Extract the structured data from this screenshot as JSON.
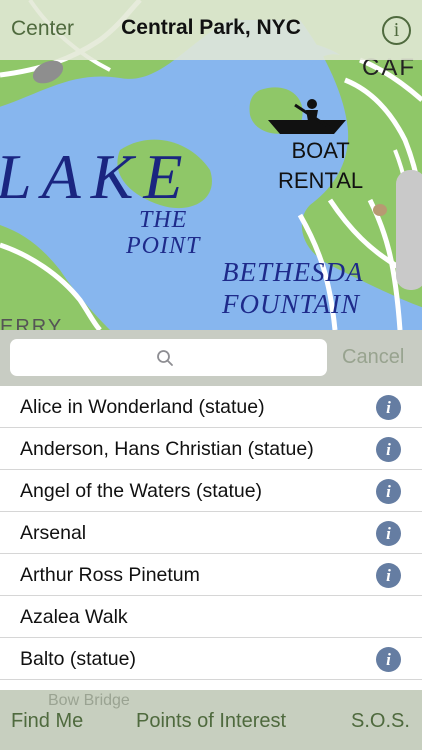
{
  "header": {
    "center_label": "Center",
    "title": "Central Park, NYC",
    "info_label": "i"
  },
  "map": {
    "labels": {
      "lake": "LAKE",
      "the_point": "THE\nPOINT",
      "boat_rental": "BOAT\nRENTAL",
      "bethesda": "BETHESDA\nFOUNTAIN",
      "caf": "CAF",
      "terry": "ERRY"
    },
    "colors": {
      "grass": "#8fc768",
      "water": "#87b6ee",
      "path": "#ffffff",
      "label": "#1e2a8a"
    }
  },
  "search": {
    "placeholder": "",
    "value": "",
    "cancel_label": "Cancel"
  },
  "list": {
    "info_glyph": "i",
    "items": [
      {
        "label": "Alice in Wonderland (statue)",
        "has_info": true
      },
      {
        "label": "Anderson, Hans Christian (statue)",
        "has_info": true
      },
      {
        "label": "Angel of the Waters (statue)",
        "has_info": true
      },
      {
        "label": "Arsenal",
        "has_info": true
      },
      {
        "label": "Arthur Ross Pinetum",
        "has_info": true
      },
      {
        "label": "Azalea Walk",
        "has_info": false
      },
      {
        "label": "Balto (statue)",
        "has_info": true
      },
      {
        "label": "",
        "has_info": false
      }
    ]
  },
  "bottom_bar": {
    "faded_text": "Bow Bridge",
    "tabs": [
      {
        "label": "Find Me"
      },
      {
        "label": "Points of Interest"
      },
      {
        "label": "S.O.S."
      }
    ]
  }
}
